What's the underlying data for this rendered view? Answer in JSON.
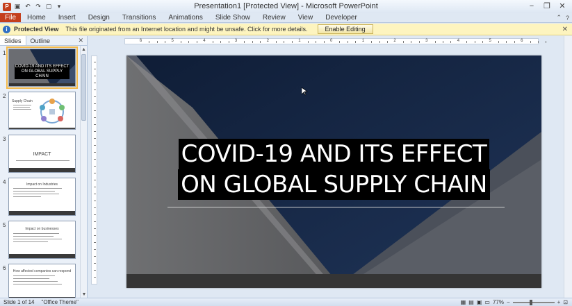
{
  "window": {
    "title": "Presentation1 [Protected View] - Microsoft PowerPoint",
    "app_icon": "P",
    "qat": [
      "save-icon",
      "undo-icon",
      "redo-icon",
      "new-icon",
      "dropdown-icon"
    ],
    "controls": {
      "minimize": "−",
      "restore": "❐",
      "close": "✕"
    }
  },
  "ribbon": {
    "file_label": "File",
    "tabs": [
      "Home",
      "Insert",
      "Design",
      "Transitions",
      "Animations",
      "Slide Show",
      "Review",
      "View",
      "Developer"
    ],
    "right_icons": {
      "minimize_ribbon": "⌃",
      "help": "?"
    }
  },
  "protected_view": {
    "title": "Protected View",
    "message": "This file originated from an Internet location and might be unsafe. Click for more details.",
    "enable_button": "Enable Editing",
    "close": "✕"
  },
  "panel": {
    "tabs": [
      "Slides",
      "Outline"
    ],
    "close": "✕",
    "thumbnails": [
      {
        "number": "1",
        "text": "COVID-19 AND ITS EFFECT ON GLOBAL SUPPLY CHAIN"
      },
      {
        "number": "2",
        "text": "Supply Chain"
      },
      {
        "number": "3",
        "text": "IMPACT"
      },
      {
        "number": "4",
        "text": "Impact on Industries"
      },
      {
        "number": "5",
        "text": "Impact on businesses"
      },
      {
        "number": "6",
        "text": "How affected companies can respond"
      }
    ]
  },
  "ruler": {
    "h_labels": [
      "6",
      "5",
      "4",
      "3",
      "2",
      "1",
      "0",
      "1",
      "2",
      "3",
      "4",
      "5",
      "6"
    ]
  },
  "slide": {
    "title_line1": "COVID-19 AND ITS EFFECT",
    "title_line2": "ON GLOBAL SUPPLY CHAIN"
  },
  "status": {
    "slide_counter": "Slide 1 of 14",
    "theme": "\"Office Theme\"",
    "zoom": "77%",
    "zoom_minus": "−",
    "zoom_plus": "+"
  },
  "colors": {
    "file_tab": "#c43e1c",
    "protected_bar": "#fdf4bf",
    "slide_sky": "#152440"
  }
}
